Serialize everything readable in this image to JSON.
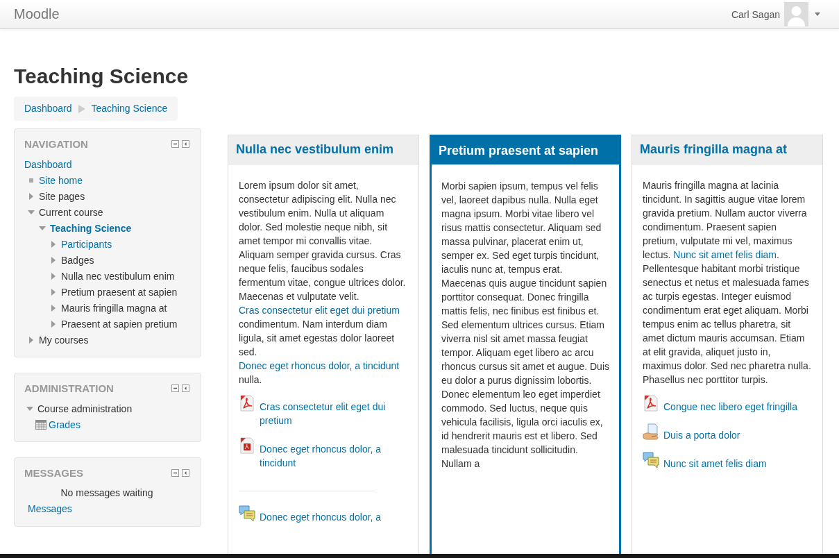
{
  "navbar": {
    "brand": "Moodle",
    "user_name": "Carl Sagan"
  },
  "page_title": "Teaching Science",
  "breadcrumb": [
    "Dashboard",
    "Teaching Science"
  ],
  "blocks": [
    {
      "kind": "tree",
      "title": "NAVIGATION",
      "tree": [
        {
          "kind": "plain",
          "label": "Dashboard",
          "link": true,
          "current": false,
          "children": [
            {
              "kind": "bullet",
              "label": "Site home",
              "link": true,
              "current": false
            },
            {
              "kind": "branch",
              "label": "Site pages",
              "link": false,
              "current": false,
              "expanded": false
            },
            {
              "kind": "branch",
              "label": "Current course",
              "link": false,
              "current": false,
              "expanded": true,
              "children": [
                {
                  "kind": "branch",
                  "label": "Teaching Science",
                  "link": true,
                  "current": true,
                  "expanded": true,
                  "children": [
                    {
                      "kind": "branch",
                      "label": "Participants",
                      "link": true,
                      "current": false,
                      "expanded": false
                    },
                    {
                      "kind": "branch",
                      "label": "Badges",
                      "link": false,
                      "current": false,
                      "expanded": false
                    },
                    {
                      "kind": "branch",
                      "label": "Nulla nec vestibulum enim",
                      "link": false,
                      "current": false,
                      "expanded": false
                    },
                    {
                      "kind": "branch",
                      "label": "Pretium praesent at sapien",
                      "link": false,
                      "current": false,
                      "expanded": false
                    },
                    {
                      "kind": "branch",
                      "label": "Mauris fringilla magna at",
                      "link": false,
                      "current": false,
                      "expanded": false
                    },
                    {
                      "kind": "branch",
                      "label": "Praesent at sapien pretium",
                      "link": false,
                      "current": false,
                      "expanded": false
                    }
                  ]
                }
              ]
            },
            {
              "kind": "branch",
              "label": "My courses",
              "link": false,
              "current": false,
              "expanded": false
            }
          ]
        }
      ]
    },
    {
      "kind": "tree",
      "title": "ADMINISTRATION",
      "tree": [
        {
          "kind": "branch",
          "label": "Course administration",
          "link": false,
          "current": false,
          "expanded": true,
          "children": [
            {
              "kind": "grades",
              "label": "Grades",
              "link": true,
              "current": false
            }
          ]
        }
      ]
    },
    {
      "kind": "messages",
      "title": "MESSAGES",
      "status": "No messages waiting",
      "link": "Messages"
    }
  ],
  "sections": [
    {
      "title": "Nulla nec vestibulum enim",
      "selected": false,
      "paragraph": [
        {
          "kind": "text",
          "text": "Lorem ipsum dolor sit amet, consectetur adipiscing elit. Nulla nec vestibulum enim. Nulla ut aliquam dolor. Sed molestie neque nibh, sit amet tempor mi convallis vitae. Aliquam semper gravida cursus. Cras neque felis, faucibus sodales fermentum vitae, congue ultrices dolor. Maecenas et vulputate velit. "
        },
        {
          "kind": "link",
          "text": "Cras consectetur elit eget dui pretium"
        },
        {
          "kind": "text",
          "text": " condimentum. Nam interdum diam ligula, sit amet egestas dolor laoreet sed. "
        },
        {
          "kind": "link",
          "text": "Donec eget rhoncus dolor, a tincidunt"
        },
        {
          "kind": "text",
          "text": " nulla."
        }
      ],
      "activity_groups": [
        [
          {
            "kind": "pdf",
            "label": "Cras consectetur elit eget dui pretium"
          },
          {
            "kind": "document",
            "label": "Donec eget rhoncus dolor, a tincidunt"
          }
        ],
        [
          {
            "kind": "forum",
            "label": "Donec eget rhoncus dolor, a"
          }
        ]
      ]
    },
    {
      "title": "Pretium praesent at sapien",
      "selected": true,
      "paragraph": [
        {
          "kind": "text",
          "text": "Morbi sapien ipsum, tempus vel felis vel, laoreet dapibus nulla. Nulla eget magna ipsum. Morbi vitae libero vel risus mattis consectetur. Aliquam sed massa pulvinar, placerat enim ut, semper ex. Sed eget turpis tincidunt, iaculis nunc at, tempus erat. Maecenas quis augue tincidunt sapien porttitor consequat. Donec fringilla mattis felis, nec finibus est finibus et. Sed elementum ultrices cursus. Etiam viverra nisl sit amet massa feugiat tempor. Aliquam eget libero ac arcu rhoncus cursus sit amet et augue. Duis eu dolor a purus dignissim lobortis. Donec elementum leo eget imperdiet commodo. Sed luctus, neque quis vehicula facilisis, ligula orci iaculis ex, id hendrerit mauris est et libero. Sed malesuada tincidunt sollicitudin. Nullam a"
        }
      ]
    },
    {
      "title": "Mauris fringilla magna at",
      "selected": false,
      "paragraph": [
        {
          "kind": "text",
          "text": "Mauris fringilla magna at lacinia tincidunt. In sagittis augue vitae lorem gravida pretium. Nullam auctor viverra condimentum. Praesent sapien pretium, vulputate mi vel, maximus lectus. "
        },
        {
          "kind": "link",
          "text": "Nunc sit amet felis diam"
        },
        {
          "kind": "text",
          "text": ". Pellentesque habitant morbi tristique senectus et netus et malesuada fames ac turpis egestas. Integer euismod condimentum erat eget aliquam. Morbi tempus enim ac tellus pharetra, sit amet dictum mauris accumsan. Etiam at elit gravida, aliquet justo in, maximus dolor. Sed nec pharetra nulla. Phasellus nec porttitor turpis."
        }
      ],
      "activity_groups": [
        [
          {
            "kind": "pdf",
            "label": "Congue nec libero eget fringilla"
          },
          {
            "kind": "page",
            "label": "Duis a porta dolor"
          },
          {
            "kind": "forum",
            "label": "Nunc sit amet felis diam"
          }
        ]
      ]
    }
  ]
}
